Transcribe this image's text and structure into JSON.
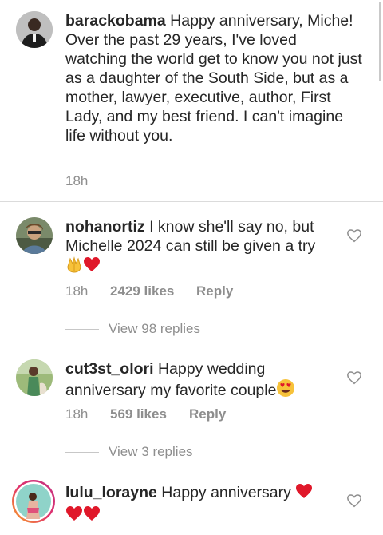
{
  "caption": {
    "username": "barackobama",
    "text": " Happy anniversary, Miche! Over the past 29 years, I've loved watching the world get to know you not just as a daughter of the South Side, but as a mother, lawyer, executive, author, First Lady, and my best friend. I can't imagine life without you.",
    "time": "18h"
  },
  "comments": [
    {
      "username": "nohanortiz",
      "text": " I know she'll say no, but Michelle 2024 can still be given a try",
      "emoji": [
        "raised-hands",
        "red-heart"
      ],
      "time": "18h",
      "likes": "2429 likes",
      "reply_label": "Reply",
      "view_replies": "View 98 replies"
    },
    {
      "username": "cut3st_olori",
      "text": " Happy wedding anniversary my favorite couple",
      "emoji": [
        "heart-eyes-face"
      ],
      "time": "18h",
      "likes": "569 likes",
      "reply_label": "Reply",
      "view_replies": "View 3 replies"
    },
    {
      "username": "lulu_lorayne",
      "text": " Happy anniversary ",
      "emoji": [
        "red-heart",
        "red-heart",
        "red-heart"
      ]
    }
  ],
  "icons": {
    "like": "heart-outline-icon",
    "story_ring": "gradient-ring"
  },
  "colors": {
    "text": "#262626",
    "muted": "#8e8e8e",
    "divider": "#dbdbdb",
    "heart": "#e0182a"
  }
}
